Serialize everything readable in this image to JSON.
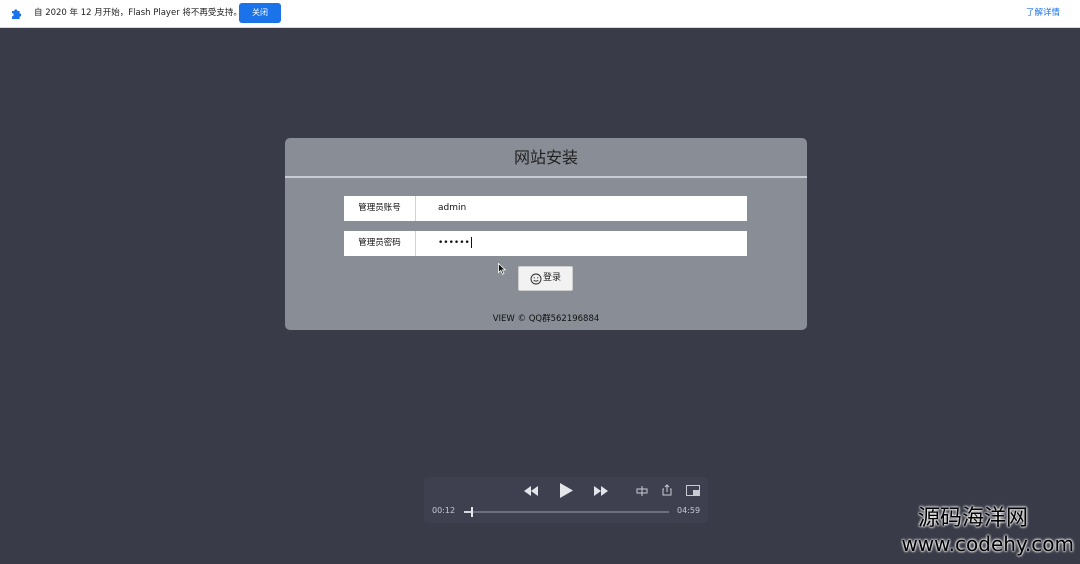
{
  "notify": {
    "message": "自 2020 年 12 月开始，Flash Player 将不再受支持。",
    "close_label": "关闭",
    "learn_more": "了解详情",
    "icon": "puzzle-icon"
  },
  "panel": {
    "title": "网站安装",
    "fields": [
      {
        "label": "管理员账号",
        "value": "admin"
      },
      {
        "label": "管理员密码",
        "value": "••••••"
      }
    ],
    "login_label": "登录",
    "login_icon": "smile-icon",
    "footer": "VIEW © QQ群562196884"
  },
  "player": {
    "current_time": "00:12",
    "total_time": "04:59",
    "progress_fraction": 0.04
  },
  "watermark": {
    "line1": "源码海洋网",
    "line2": "www.codehy.com"
  },
  "colors": {
    "background": "#393b48",
    "panel": "#888d96",
    "accent": "#1a73e8"
  }
}
